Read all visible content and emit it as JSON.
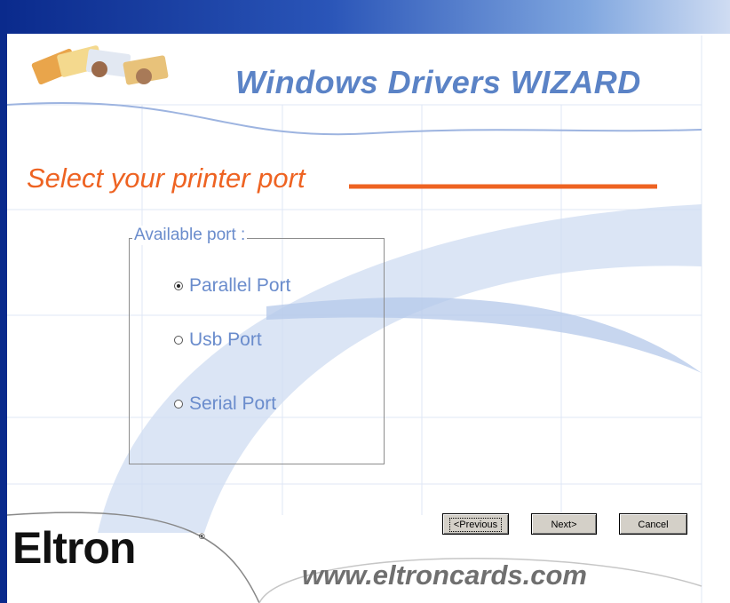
{
  "header": {
    "title": "Windows Drivers WIZARD"
  },
  "section": {
    "title": "Select your printer port"
  },
  "port_group": {
    "legend": "Available port  :",
    "options": [
      {
        "label": "Parallel Port",
        "selected": true
      },
      {
        "label": "Usb Port",
        "selected": false
      },
      {
        "label": "Serial Port",
        "selected": false
      }
    ]
  },
  "buttons": {
    "previous": "<Previous",
    "next": "Next>",
    "cancel": "Cancel"
  },
  "footer": {
    "brand": "Eltron",
    "brand_mark": "®",
    "url": "www.eltroncards.com"
  },
  "colors": {
    "title_blue": "#5b83c6",
    "accent_orange": "#ee6322",
    "label_blue": "#6a8ccc",
    "window_blue": "#0a2a8c"
  }
}
